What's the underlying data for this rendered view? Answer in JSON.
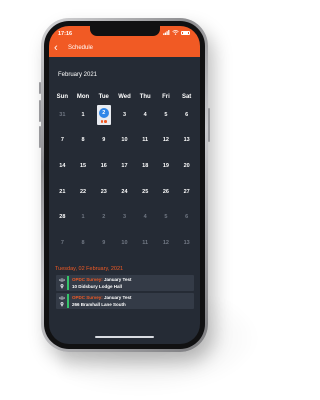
{
  "status_bar": {
    "time": "17:16",
    "signal_icon": "signal-icon",
    "wifi_icon": "wifi-icon",
    "battery_icon": "battery-icon"
  },
  "nav": {
    "back_icon": "chevron-left-icon",
    "title": "Schedule"
  },
  "calendar": {
    "month_label": "February 2021",
    "weekdays": [
      "Sun",
      "Mon",
      "Tue",
      "Wed",
      "Thu",
      "Fri",
      "Sat"
    ],
    "weeks": [
      [
        "31",
        "1",
        "2",
        "3",
        "4",
        "5",
        "6"
      ],
      [
        "7",
        "8",
        "9",
        "10",
        "11",
        "12",
        "13"
      ],
      [
        "14",
        "15",
        "16",
        "17",
        "18",
        "19",
        "20"
      ],
      [
        "21",
        "22",
        "23",
        "24",
        "25",
        "26",
        "27"
      ],
      [
        "28",
        "1",
        "2",
        "3",
        "4",
        "5",
        "6"
      ],
      [
        "7",
        "8",
        "9",
        "10",
        "11",
        "12",
        "13"
      ]
    ],
    "selected_date": "2",
    "selected_event_count": 2
  },
  "schedule": {
    "date_heading": "Tuesday, 02 February, 2021",
    "events": [
      {
        "type_label": "OPDC Survey:",
        "title": "January Test",
        "location": "10 Didsbury Lodge Hall",
        "eye_icon": "eye-icon",
        "pin_icon": "location-pin-icon"
      },
      {
        "type_label": "OPDC Survey:",
        "title": "January Test",
        "location": "266 Bramhall Lane South",
        "eye_icon": "eye-icon",
        "pin_icon": "location-pin-icon"
      }
    ]
  },
  "colors": {
    "accent": "#f15a24",
    "background": "#252b35",
    "selected": "#2f86e8",
    "event_bar": "#35c46a"
  }
}
